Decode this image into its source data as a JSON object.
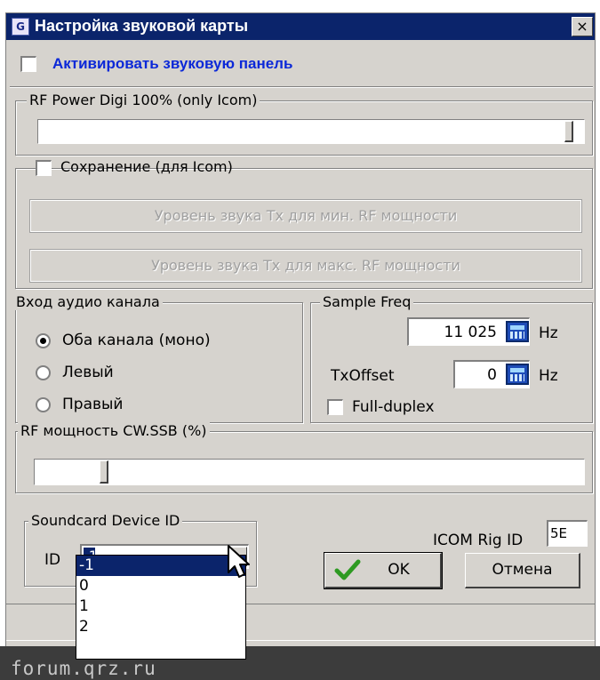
{
  "window": {
    "title": "Настройка звуковой карты",
    "icon_letter": "G",
    "close_glyph": "×"
  },
  "activate": {
    "label": "Активировать звуковую панель",
    "checked": false
  },
  "rf_power_digi": {
    "caption": "RF Power Digi 100% (only Icom)",
    "level_fraction": 0.98
  },
  "save": {
    "label": "Сохранение (для Icom)",
    "checked": false,
    "btn_min": "Уровень звука Tx для мин. RF мощности",
    "btn_max": "Уровень звука Tx для макс. RF мощности"
  },
  "audio_input": {
    "caption": "Вход аудио канала",
    "options": [
      "Оба канала (моно)",
      "Левый",
      "Правый"
    ],
    "selected": "Оба канала (моно)"
  },
  "sample": {
    "caption": "Sample Freq",
    "freq_value": "11 025",
    "freq_unit": "Hz",
    "txoffset_label": "TxOffset",
    "txoffset_value": "0",
    "txoffset_unit": "Hz",
    "fullduplex_label": "Full-duplex",
    "fullduplex_checked": false
  },
  "rf_cw_ssb": {
    "caption": "RF мощность CW.SSB (%)",
    "level_fraction": 0.12
  },
  "soundcard": {
    "caption": "Soundcard Device ID",
    "id_label": "ID",
    "selected_value": "-1",
    "options": [
      "-1",
      "0",
      "1",
      "2"
    ]
  },
  "icom": {
    "label": "ICOM Rig ID",
    "value": "5E"
  },
  "buttons": {
    "ok": "OK",
    "cancel": "Отмена"
  },
  "watermark": "forum.qrz.ru",
  "colors": {
    "title_bar": "#0b246b",
    "face": "#d6d3ce",
    "activate_text": "#0b28d8",
    "ok_check": "#2e9a22"
  }
}
